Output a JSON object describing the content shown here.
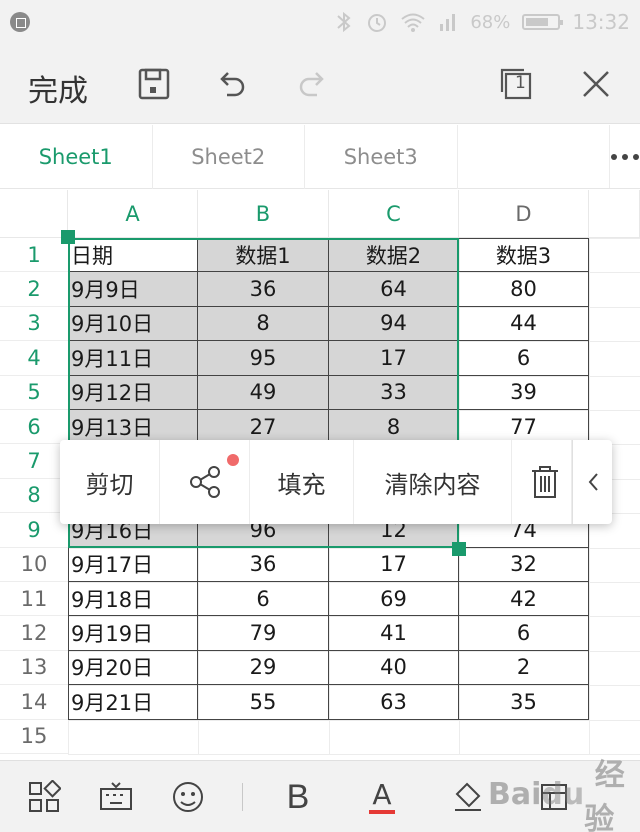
{
  "status_bar": {
    "battery_percent": "68%",
    "time": "13:32"
  },
  "toolbar": {
    "done_label": "完成",
    "icons": [
      "save-icon",
      "undo-icon",
      "redo-icon",
      "switch-window-icon",
      "close-icon"
    ],
    "window_count": "1"
  },
  "tabs": {
    "items": [
      {
        "label": "Sheet1",
        "active": true
      },
      {
        "label": "Sheet2",
        "active": false
      },
      {
        "label": "Sheet3",
        "active": false
      }
    ],
    "more_icon": "more-icon"
  },
  "sheet": {
    "columns": [
      "A",
      "B",
      "C",
      "D"
    ],
    "row_numbers": [
      "1",
      "2",
      "3",
      "4",
      "5",
      "6",
      "7",
      "8",
      "9",
      "10",
      "11",
      "12",
      "13",
      "14",
      "15"
    ],
    "header_row": [
      "日期",
      "数据1",
      "数据2",
      "数据3"
    ],
    "rows": [
      [
        "9月9日",
        "36",
        "64",
        "80"
      ],
      [
        "9月10日",
        "8",
        "94",
        "44"
      ],
      [
        "9月11日",
        "95",
        "17",
        "6"
      ],
      [
        "9月12日",
        "49",
        "33",
        "39"
      ],
      [
        "9月13日",
        "27",
        "8",
        "77"
      ],
      [
        "",
        "",
        "",
        ""
      ],
      [
        "",
        "",
        "",
        ""
      ],
      [
        "9月16日",
        "96",
        "12",
        "74"
      ],
      [
        "9月17日",
        "36",
        "17",
        "32"
      ],
      [
        "9月18日",
        "6",
        "69",
        "42"
      ],
      [
        "9月19日",
        "79",
        "41",
        "6"
      ],
      [
        "9月20日",
        "29",
        "40",
        "2"
      ],
      [
        "9月21日",
        "55",
        "63",
        "35"
      ]
    ],
    "selection": "A1:C9",
    "accent_color": "#1a9a6c"
  },
  "context_menu": {
    "cut_label": "剪切",
    "fill_label": "填充",
    "clear_label": "清除内容",
    "icons": [
      "share-icon",
      "delete-icon",
      "chevron-left-icon"
    ]
  },
  "bottom_bar": {
    "bold_label": "B",
    "font_color_label": "A",
    "icons": [
      "apps-icon",
      "keyboard-icon",
      "emoji-icon",
      "bold-icon",
      "font-color-icon",
      "fill-color-icon",
      "format-icon"
    ]
  }
}
